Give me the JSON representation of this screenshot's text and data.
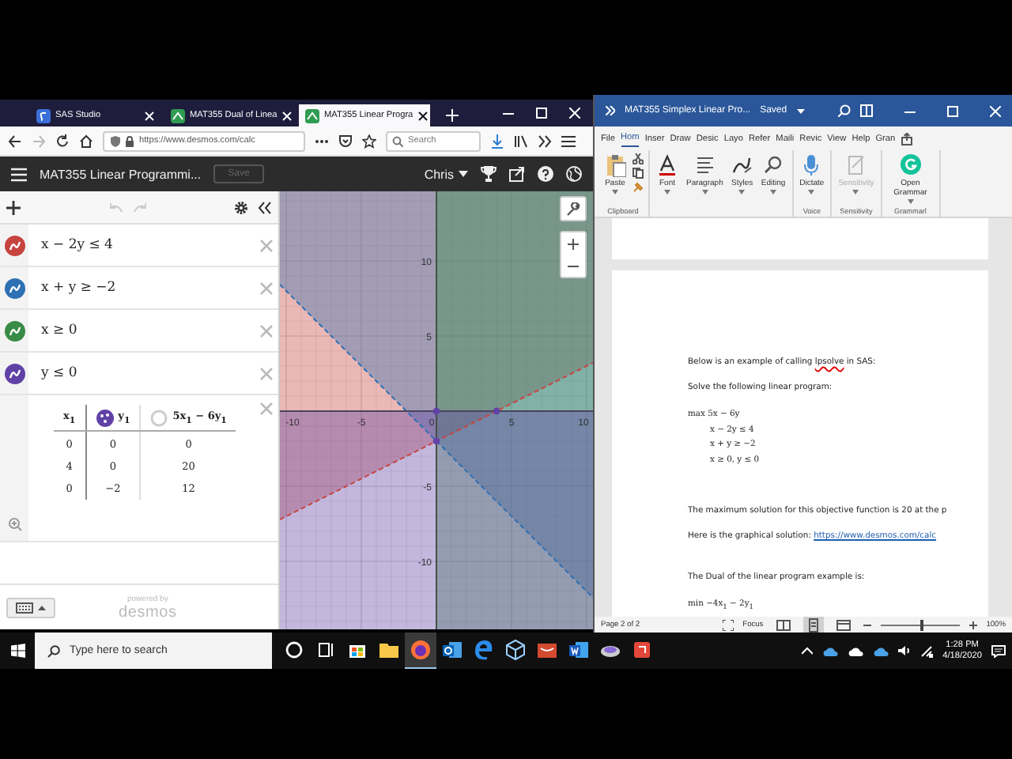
{
  "browser": {
    "tabs": [
      {
        "label": "SAS Studio",
        "kind": "sas",
        "selected": false
      },
      {
        "label": "MAT355 Dual of Linea",
        "kind": "desmos",
        "selected": false
      },
      {
        "label": "MAT355 Linear Progra",
        "kind": "desmos",
        "selected": true
      }
    ],
    "url": "https://www.desmos.com/calc",
    "search": {
      "placeholder": "Search"
    }
  },
  "desmos": {
    "title": "MAT355 Linear Programmi...",
    "save": {
      "label": "Save",
      "disabled": true
    },
    "user": "Chris",
    "expressions": [
      {
        "latex": "x − 2y ≤ 4",
        "color": "#c74440"
      },
      {
        "latex": "x + y ≥ −2",
        "color": "#2d70b3"
      },
      {
        "latex": "x ≥ 0",
        "color": "#388c46"
      },
      {
        "latex": "y ≤ 0",
        "color": "#6042a6"
      }
    ],
    "table": {
      "columns": [
        {
          "label": "x$_{1}$"
        },
        {
          "label": "y$_{1}$",
          "shown": true
        },
        {
          "label": "5x$_{1}$ − 6y$_{1}$",
          "shown": false
        }
      ],
      "rows": [
        [
          "0",
          "0",
          "0"
        ],
        [
          "4",
          "0",
          "20"
        ],
        [
          "0",
          "−2",
          "12"
        ]
      ]
    },
    "branding": {
      "caption": "powered by",
      "logo": "desmos"
    },
    "graph": {
      "x_ticks": [
        "-10",
        "-5",
        "0",
        "5",
        "10"
      ],
      "y_ticks": [
        "10",
        "5",
        "-5",
        "-10"
      ]
    }
  },
  "word": {
    "title": "MAT355 Simplex Linear Pro...",
    "save_state": "Saved",
    "ribbon_tabs": [
      {
        "label": "File",
        "selected": false
      },
      {
        "label": "Hom",
        "selected": true
      },
      {
        "label": "Inser",
        "selected": false
      },
      {
        "label": "Draw",
        "selected": false
      },
      {
        "label": "Desic",
        "selected": false
      },
      {
        "label": "Layo",
        "selected": false
      },
      {
        "label": "Refer",
        "selected": false
      },
      {
        "label": "Maili",
        "selected": false
      },
      {
        "label": "Revic",
        "selected": false
      },
      {
        "label": "View",
        "selected": false
      },
      {
        "label": "Help",
        "selected": false
      },
      {
        "label": "Gran",
        "selected": false
      }
    ],
    "ribbon_groups": [
      {
        "label": "Clipboard",
        "buttons": [
          {
            "label": "Paste",
            "kind": "paste",
            "disabled": false
          }
        ]
      },
      {
        "buttons": [
          {
            "label": "Font",
            "kind": "font",
            "disabled": false
          },
          {
            "label": "Paragraph",
            "kind": "paragraph",
            "disabled": false
          },
          {
            "label": "Styles",
            "kind": "styles",
            "disabled": false
          },
          {
            "label": "Editing",
            "kind": "editing",
            "disabled": false
          }
        ]
      },
      {
        "label": "Voice",
        "buttons": [
          {
            "label": "Dictate",
            "kind": "dictate",
            "disabled": false
          }
        ]
      },
      {
        "label": "Sensitivity",
        "buttons": [
          {
            "label": "Sensitivity",
            "kind": "sensitivity",
            "disabled": true
          }
        ]
      },
      {
        "label": "Grammarl",
        "buttons": [
          {
            "label": "Open Grammar",
            "kind": "grammarly",
            "disabled": false
          }
        ]
      }
    ],
    "blocks": [
      {
        "kind": "spell",
        "before": "Below is an example of calling ",
        "flagged": "lpsolve",
        "after": " in SAS:"
      },
      {
        "kind": "text",
        "text": "Solve the following linear program:"
      },
      {
        "kind": "math",
        "lines": [
          {
            "text": "max 5x − 6y",
            "indented": false
          },
          {
            "text": "x − 2y ≤ 4",
            "indented": true
          },
          {
            "text": "x + y ≥ −2",
            "indented": true
          },
          {
            "text": "x ≥ 0, y ≤ 0",
            "indented": true
          }
        ]
      },
      {
        "kind": "text",
        "text": "The maximum solution for this objective function is 20 at the p"
      },
      {
        "kind": "link",
        "text": "Here is the graphical solution: ",
        "link": "https://www.desmos.com/calc"
      },
      {
        "kind": "text",
        "text": "The Dual of the linear program example is:"
      },
      {
        "kind": "math",
        "lines": [
          {
            "text": "min −4x$_{1}$ − 2y$_{1}$",
            "indented": false
          }
        ]
      }
    ],
    "status": {
      "page": "Page 2 of 2",
      "focus": "Focus",
      "views": [
        {
          "kind": "read",
          "selected": false
        },
        {
          "kind": "print",
          "selected": true
        },
        {
          "kind": "web",
          "selected": false
        }
      ],
      "zoom_slider": {
        "level": 0.5
      },
      "zoom": "100%"
    }
  },
  "taskbar": {
    "search": {
      "placeholder": "Type here to search"
    },
    "apps": [
      {
        "kind": "cortana",
        "selected": false
      },
      {
        "kind": "taskview",
        "selected": false
      },
      {
        "kind": "store",
        "selected": false
      },
      {
        "kind": "explorer",
        "selected": false
      },
      {
        "kind": "firefox",
        "selected": true
      },
      {
        "kind": "outlook",
        "selected": false
      },
      {
        "kind": "edge",
        "selected": false
      },
      {
        "kind": "cube",
        "selected": false
      },
      {
        "kind": "toolbox",
        "selected": false
      },
      {
        "kind": "word",
        "selected": false
      },
      {
        "kind": "disk",
        "selected": false
      },
      {
        "kind": "slides",
        "selected": false
      }
    ],
    "time": "1:28 PM",
    "date": "4/18/2020"
  }
}
